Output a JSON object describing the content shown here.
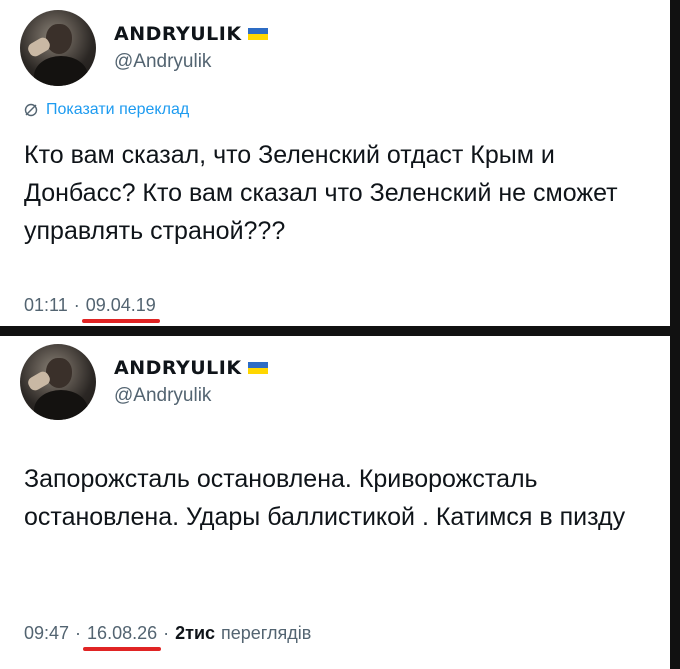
{
  "tweet1": {
    "display_name": "ANDRYULIK",
    "handle": "@Andryulik",
    "translate_label": "Показати переклад",
    "text": "Кто вам сказал, что Зеленский отдаст Крым и Донбасс? Кто вам сказал что Зеленский не сможет управлять страной???",
    "time": "01:11",
    "separator": "·",
    "date": "09.04.19"
  },
  "tweet2": {
    "display_name": "ANDRYULIK",
    "handle": "@Andryulik",
    "text": "Запорожсталь остановлена. Криворожсталь остановлена. Удары баллистикой . Катимся в пизду",
    "time": "09:47",
    "separator": "·",
    "date": "16.08.26",
    "views_count": "2тис",
    "views_label": "переглядів"
  },
  "icons": [
    "globe-icon",
    "ukraine-flag-icon",
    "avatar"
  ],
  "colors": {
    "link": "#1d9bf0",
    "secondary_text": "#536471",
    "underline": "#e02424",
    "flag_blue": "#2d6cc4",
    "flag_yellow": "#ffd700"
  }
}
